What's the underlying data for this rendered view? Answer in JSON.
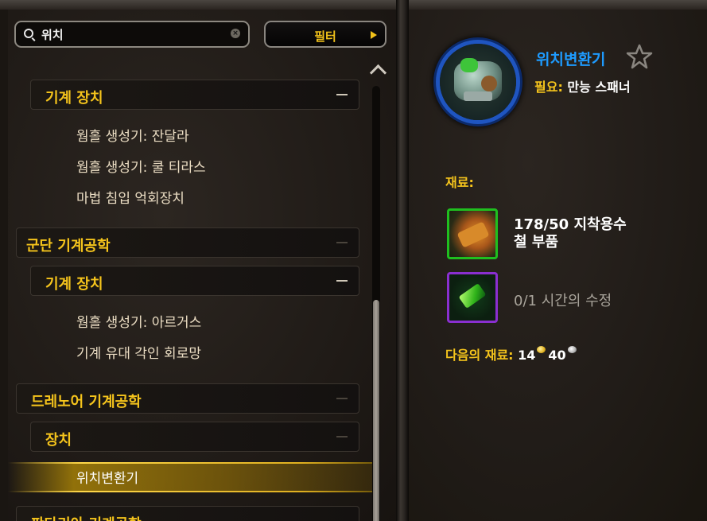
{
  "search": {
    "value": "위치",
    "placeholder": ""
  },
  "filter": {
    "label": "필터"
  },
  "tree": {
    "group1": {
      "subheader": "기계 장치",
      "items": [
        "웜홀 생성기: 잔달라",
        "웜홀 생성기: 쿨 티라스",
        "마법 침입 억회장치"
      ]
    },
    "group2": {
      "header": "군단 기계공학",
      "subheader": "기계 장치",
      "items": [
        "웜홀 생성기: 아르거스",
        "기계 유대 각인 회로망"
      ]
    },
    "group3": {
      "header": "드레노어 기계공학",
      "subheader": "장치",
      "selected_item": "위치변환기"
    },
    "group4": {
      "header": "판다리아 기계공학"
    }
  },
  "detail": {
    "recipe_name": "위치변환기",
    "requires_label": "필요:",
    "requires_value": "만능 스패너",
    "reagents_title": "재료:",
    "reagents": [
      {
        "count": "178/50",
        "name_line1": "지착용수",
        "name_line2": "철 부품"
      },
      {
        "count": "0/1",
        "name": "시간의 수정"
      }
    ],
    "optional_label": "다음의 재료:",
    "gold": "14",
    "silver": "40"
  },
  "colors": {
    "header_gold": "#f5c41c",
    "recipe_blue": "#1e9bff",
    "uncommon_green": "#1fbf1f",
    "epic_purple": "#8a2fd0"
  }
}
